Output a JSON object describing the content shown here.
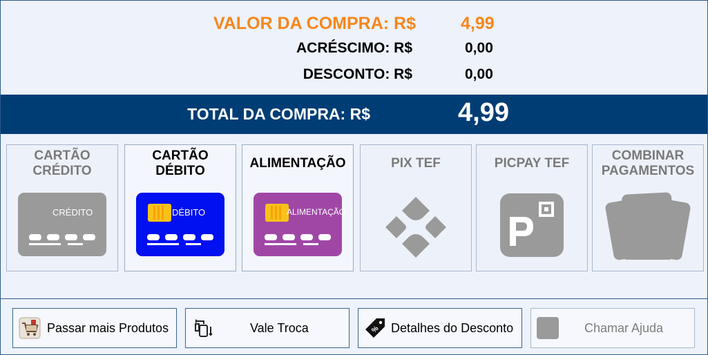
{
  "summary": {
    "valor_label": "VALOR DA COMPRA: R$",
    "valor_value": "4,99",
    "acrescimo_label": "ACRÉSCIMO: R$",
    "acrescimo_value": "0,00",
    "desconto_label": "DESCONTO: R$",
    "desconto_value": "0,00",
    "total_label": "TOTAL DA COMPRA: R$",
    "total_value": "4,99"
  },
  "payments": [
    {
      "label": "CARTÃO\nCRÉDITO",
      "card_text": "CRÉDITO",
      "icon": "credit-card-icon",
      "enabled": false
    },
    {
      "label": "CARTÃO\nDÉBITO",
      "card_text": "DÉBITO",
      "icon": "debit-card-icon",
      "enabled": true
    },
    {
      "label": "ALIMENTAÇÃO",
      "card_text": "ALIMENTAÇÃO",
      "icon": "meal-card-icon",
      "enabled": true
    },
    {
      "label": "PIX TEF",
      "icon": "pix-icon",
      "enabled": false
    },
    {
      "label": "PICPAY TEF",
      "icon": "picpay-icon",
      "enabled": false
    },
    {
      "label": "COMBINAR\nPAGAMENTOS",
      "icon": "combined-cards-icon",
      "enabled": false
    }
  ],
  "buttons": {
    "passar_produtos": "Passar mais Produtos",
    "vale_troca": "Vale Troca",
    "detalhes_desconto": "Detalhes do Desconto",
    "chamar_ajuda": "Chamar Ajuda"
  },
  "colors": {
    "accent_orange": "#f7861b",
    "total_bar": "#003d75",
    "debit_card": "#0010f0",
    "meal_card": "#a047a6",
    "disabled_gray": "#9a9a9a"
  }
}
